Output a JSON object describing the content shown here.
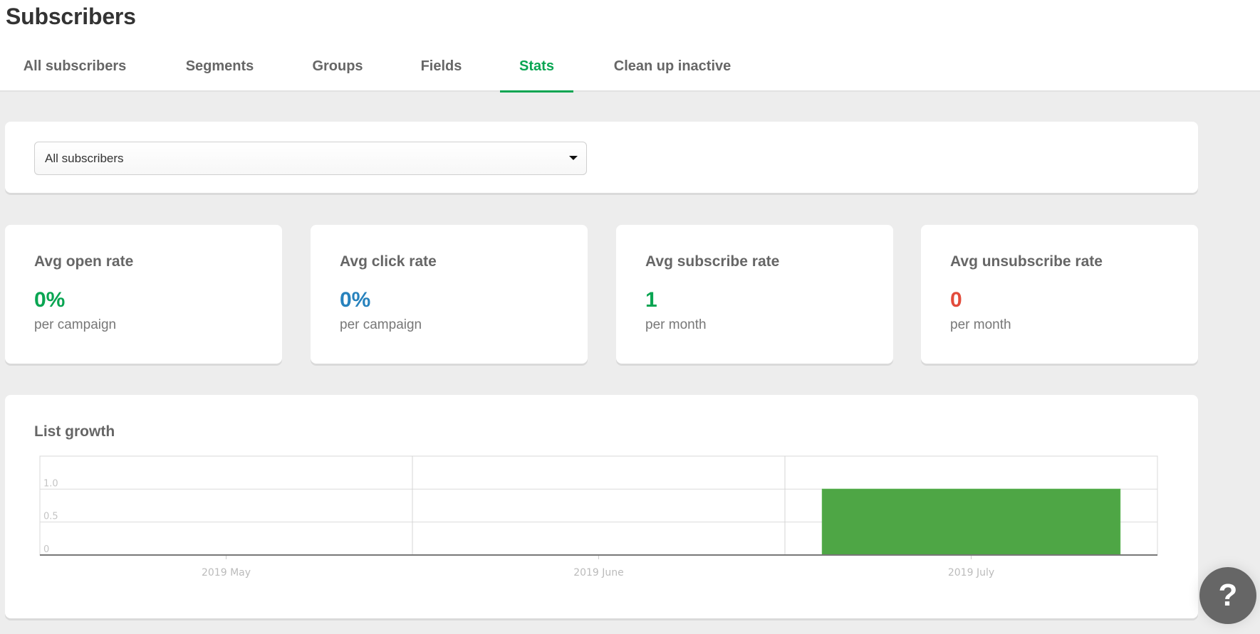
{
  "header": {
    "title": "Subscribers",
    "tabs": [
      {
        "label": "All subscribers",
        "active": false
      },
      {
        "label": "Segments",
        "active": false
      },
      {
        "label": "Groups",
        "active": false
      },
      {
        "label": "Fields",
        "active": false
      },
      {
        "label": "Stats",
        "active": true
      },
      {
        "label": "Clean up inactive",
        "active": false
      }
    ]
  },
  "filter": {
    "selected": "All subscribers",
    "icon": "caret-down-icon"
  },
  "stats": [
    {
      "title": "Avg open rate",
      "value": "0%",
      "subtitle": "per campaign",
      "color": "#09a552"
    },
    {
      "title": "Avg click rate",
      "value": "0%",
      "subtitle": "per campaign",
      "color": "#2782bd"
    },
    {
      "title": "Avg subscribe rate",
      "value": "1",
      "subtitle": "per month",
      "color": "#09a552"
    },
    {
      "title": "Avg unsubscribe rate",
      "value": "0",
      "subtitle": "per month",
      "color": "#e24b3b"
    }
  ],
  "colors": {
    "accent": "#09a552",
    "bar": "#4ea645"
  },
  "chart_data": {
    "type": "bar",
    "title": "List growth",
    "categories": [
      "2019 May",
      "2019 June",
      "2019 July"
    ],
    "values": [
      0,
      0,
      1
    ],
    "xlabel": "",
    "ylabel": "",
    "ylim": [
      0,
      1.5
    ],
    "yticks": [
      0,
      0.5,
      1.0
    ],
    "ytick_labels": [
      "0",
      "0.5",
      "1.0"
    ],
    "grid": true,
    "legend": "none"
  },
  "help": {
    "label": "?",
    "icon": "question-mark-icon"
  }
}
